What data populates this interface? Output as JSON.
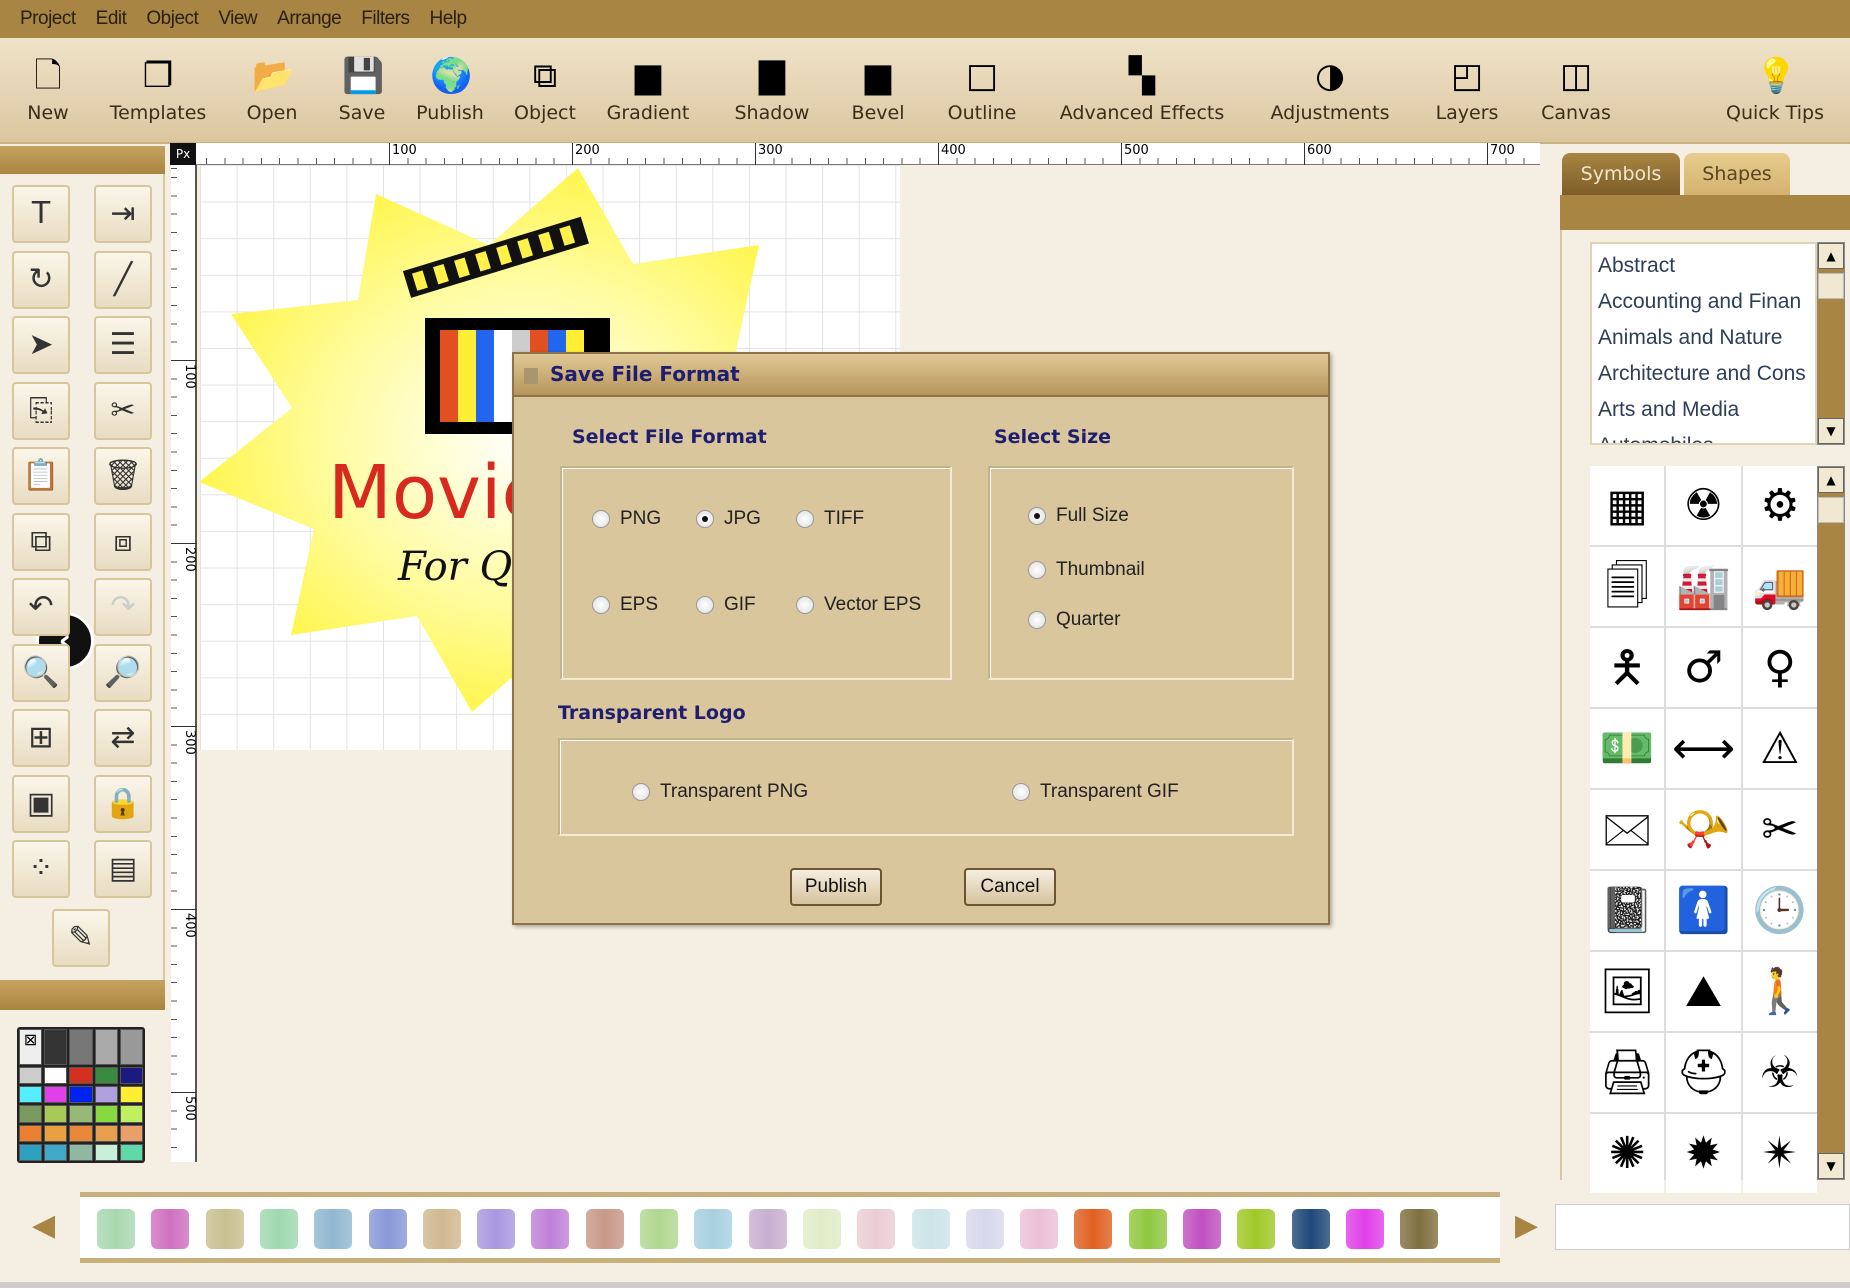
{
  "menu": [
    "Project",
    "Edit",
    "Object",
    "View",
    "Arrange",
    "Filters",
    "Help"
  ],
  "toolbar": [
    {
      "label": "New",
      "icon": "new-file-icon"
    },
    {
      "label": "Templates",
      "icon": "templates-icon"
    },
    {
      "label": "Open",
      "icon": "open-folder-icon"
    },
    {
      "label": "Save",
      "icon": "save-disk-icon"
    },
    {
      "label": "Publish",
      "icon": "globe-icon"
    },
    {
      "label": "Object",
      "icon": "object-icon"
    },
    {
      "label": "Gradient",
      "icon": "gradient-icon"
    },
    {
      "label": "Shadow",
      "icon": "shadow-icon"
    },
    {
      "label": "Bevel",
      "icon": "bevel-icon"
    },
    {
      "label": "Outline",
      "icon": "outline-icon"
    },
    {
      "label": "Advanced Effects",
      "icon": "advanced-effects-icon"
    },
    {
      "label": "Adjustments",
      "icon": "adjustments-icon"
    },
    {
      "label": "Layers",
      "icon": "layers-icon"
    },
    {
      "label": "Canvas",
      "icon": "canvas-icon"
    },
    {
      "label": "Quick Tips",
      "icon": "lightbulb-icon"
    }
  ],
  "tools": [
    "text",
    "import-image",
    "rotate",
    "line",
    "pointer",
    "arrange",
    "copy",
    "cut",
    "paste",
    "delete",
    "bring-forward",
    "send-backward",
    "undo",
    "redo",
    "zoom-in",
    "zoom-out",
    "align",
    "flip",
    "group",
    "lock",
    "distribute",
    "properties",
    "color-picker"
  ],
  "palette": [
    "#eeeeee",
    "#333333",
    "#777777",
    "#aaaaaa",
    "#999999",
    "#cccccc",
    "#ffffff",
    "#d33020",
    "#3a8a40",
    "#1a1a80",
    "#55eeff",
    "#e040e8",
    "#0022ee",
    "#b0a0e0",
    "#ffee33",
    "#7a9a60",
    "#a8c858",
    "#98b878",
    "#88d840",
    "#c0f060",
    "#e88030",
    "#e8a040",
    "#e88838",
    "#e8a050",
    "#e8a068",
    "#30a0c0",
    "#40a8c8",
    "#90b8a0",
    "#c8f0d8",
    "#60d8a8"
  ],
  "ruler": {
    "unit": "Px",
    "h_labels": [
      "100",
      "200",
      "300",
      "400",
      "500",
      "600",
      "700"
    ],
    "v_labels": [
      "100",
      "200",
      "300",
      "400",
      "500"
    ]
  },
  "canvas": {
    "logo_title": "Movie",
    "logo_subtitle": "For Qu"
  },
  "right_panel": {
    "tabs": [
      "Symbols",
      "Shapes"
    ],
    "active_tab": "Symbols",
    "categories": [
      "Abstract",
      "Accounting and Finan",
      "Animals and Nature",
      "Architecture and Cons",
      "Arts and Media",
      "Automobiles"
    ],
    "symbols": [
      "checker",
      "radiation",
      "gear",
      "documents",
      "factory",
      "vehicle",
      "person-arms",
      "male",
      "female",
      "dollar-bills",
      "connector",
      "warning-triangle",
      "framed-envelope",
      "post-horn-mail",
      "comb-scissors",
      "notebook",
      "woman",
      "clock",
      "framed-landscape",
      "globe-mountains",
      "walking-person",
      "printer",
      "helmet",
      "biohazard",
      "sunburst-1",
      "sunburst-2",
      "sunburst-3"
    ]
  },
  "swatches": [
    "#a8d8b0",
    "#d070c0",
    "#c8c090",
    "#a0d8b0",
    "#90b8d0",
    "#8898d8",
    "#d0b890",
    "#a898e0",
    "#c080d8",
    "#c89888",
    "#b0d890",
    "#a8d0e0",
    "#c8b0d0",
    "#e0ecc8",
    "#ecccd4",
    "#cce4e8",
    "#d8d8ec",
    "#ecc0d8",
    "#e06020",
    "#90c840",
    "#c050c0",
    "#a0c828",
    "#204878",
    "#e040e8",
    "#807040"
  ],
  "dialog": {
    "title": "Save File Format",
    "format_heading": "Select File Format",
    "formats": [
      {
        "label": "PNG",
        "checked": false
      },
      {
        "label": "JPG",
        "checked": true
      },
      {
        "label": "TIFF",
        "checked": false
      },
      {
        "label": "EPS",
        "checked": false
      },
      {
        "label": "GIF",
        "checked": false
      },
      {
        "label": "Vector EPS",
        "checked": false
      }
    ],
    "size_heading": "Select Size",
    "sizes": [
      {
        "label": "Full Size",
        "checked": true
      },
      {
        "label": "Thumbnail",
        "checked": false
      },
      {
        "label": "Quarter",
        "checked": false
      }
    ],
    "transparent_heading": "Transparent Logo",
    "transparent": [
      {
        "label": "Transparent PNG",
        "checked": false
      },
      {
        "label": "Transparent GIF",
        "checked": false
      }
    ],
    "publish_label": "Publish",
    "cancel_label": "Cancel"
  },
  "colors": {
    "menubar": "#a88543",
    "accent_text": "#1f1d70",
    "background": "#f5eee2"
  }
}
